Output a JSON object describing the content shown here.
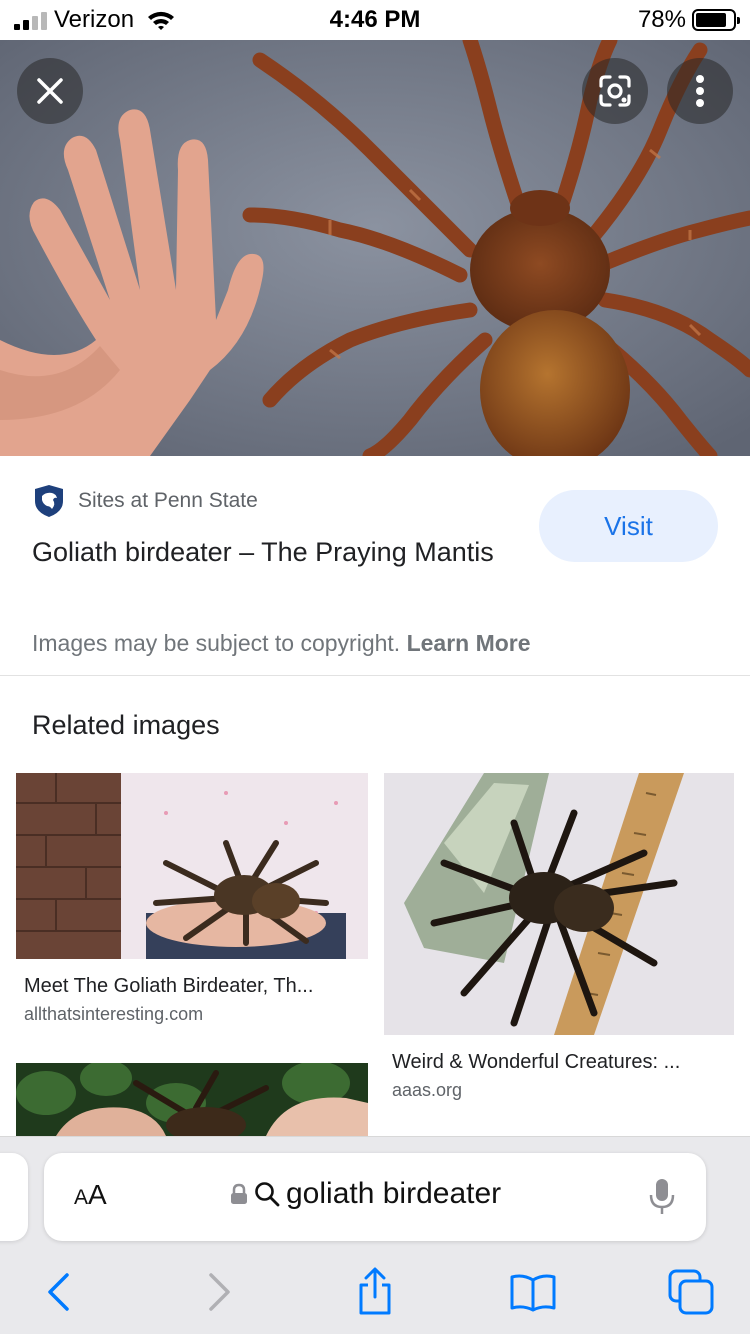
{
  "status": {
    "carrier": "Verizon",
    "time": "4:46 PM",
    "battery_pct": "78%"
  },
  "hero": {
    "close_icon": "close-icon",
    "lens_icon": "google-lens-icon",
    "more_icon": "more-vertical-icon"
  },
  "result": {
    "site_name": "Sites at Penn State",
    "title": "Goliath birdeater – The Praying Mantis",
    "visit_label": "Visit",
    "copyright_text": "Images may be subject to copyright.",
    "learn_more": "Learn More"
  },
  "related": {
    "heading": "Related images",
    "items": [
      {
        "caption": "Meet The Goliath Birdeater, Th...",
        "source": "allthatsinteresting.com"
      },
      {
        "caption": "Weird & Wonderful Creatures: ...",
        "source": "aaas.org"
      },
      {
        "caption": "",
        "source": ""
      }
    ]
  },
  "browser": {
    "aa_label_big": "A",
    "aa_label_small": "A",
    "url_text": "goliath birdeater",
    "colors": {
      "accent": "#007aff",
      "disabled": "#b0b0b4"
    }
  }
}
